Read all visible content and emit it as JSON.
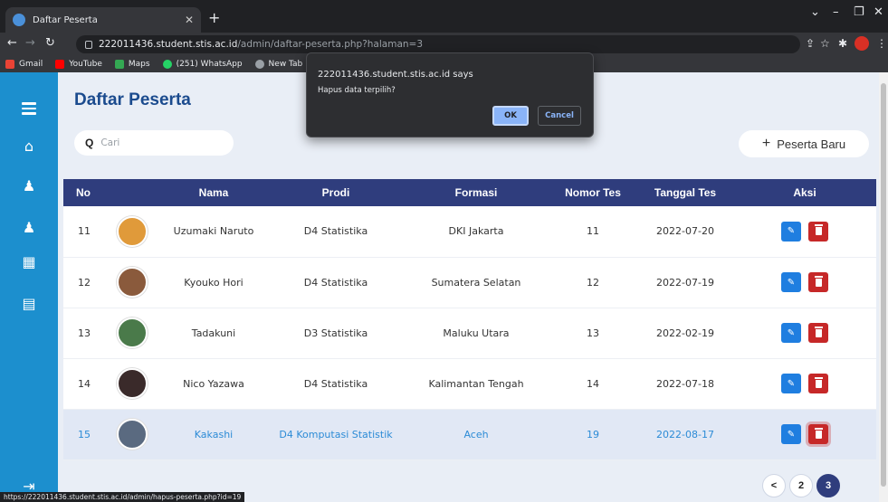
{
  "browser": {
    "tab_title": "Daftar Peserta",
    "url_host": "222011436.student.stis.ac.id",
    "url_path": "/admin/daftar-peserta.php?halaman=3",
    "bookmarks": [
      {
        "label": "Gmail",
        "color": "#ea4335"
      },
      {
        "label": "YouTube",
        "color": "#ff0000"
      },
      {
        "label": "Maps",
        "color": "#34a853"
      },
      {
        "label": "(251) WhatsApp",
        "color": "#25d366"
      },
      {
        "label": "New Tab",
        "color": "#9aa0a6"
      }
    ],
    "status_url": "https://222011436.student.stis.ac.id/admin/hapus-peserta.php?id=19"
  },
  "dialog": {
    "title": "222011436.student.stis.ac.id says",
    "message": "Hapus data terpilih?",
    "ok_label": "OK",
    "cancel_label": "Cancel"
  },
  "page": {
    "title": "Daftar Peserta",
    "search_placeholder": "Cari",
    "add_button_label": "Peserta Baru"
  },
  "table": {
    "headers": [
      "No",
      "Nama",
      "Prodi",
      "Formasi",
      "Nomor Tes",
      "Tanggal Tes",
      "Aksi"
    ],
    "rows": [
      {
        "no": "11",
        "nama": "Uzumaki Naruto",
        "prodi": "D4 Statistika",
        "formasi": "DKI Jakarta",
        "nomor_tes": "11",
        "tanggal_tes": "2022-07-20",
        "avatar_color": "#e09a3a"
      },
      {
        "no": "12",
        "nama": "Kyouko Hori",
        "prodi": "D4 Statistika",
        "formasi": "Sumatera Selatan",
        "nomor_tes": "12",
        "tanggal_tes": "2022-07-19",
        "avatar_color": "#8a5a3c"
      },
      {
        "no": "13",
        "nama": "Tadakuni",
        "prodi": "D3 Statistika",
        "formasi": "Maluku Utara",
        "nomor_tes": "13",
        "tanggal_tes": "2022-02-19",
        "avatar_color": "#4a7a4a"
      },
      {
        "no": "14",
        "nama": "Nico Yazawa",
        "prodi": "D4 Statistika",
        "formasi": "Kalimantan Tengah",
        "nomor_tes": "14",
        "tanggal_tes": "2022-07-18",
        "avatar_color": "#3a2a2a"
      },
      {
        "no": "15",
        "nama": "Kakashi",
        "prodi": "D4 Komputasi Statistik",
        "formasi": "Aceh",
        "nomor_tes": "19",
        "tanggal_tes": "2022-08-17",
        "avatar_color": "#5a6a80"
      }
    ]
  },
  "pagination": {
    "prev": "<",
    "pages": [
      "2",
      "3"
    ],
    "active": "3"
  }
}
